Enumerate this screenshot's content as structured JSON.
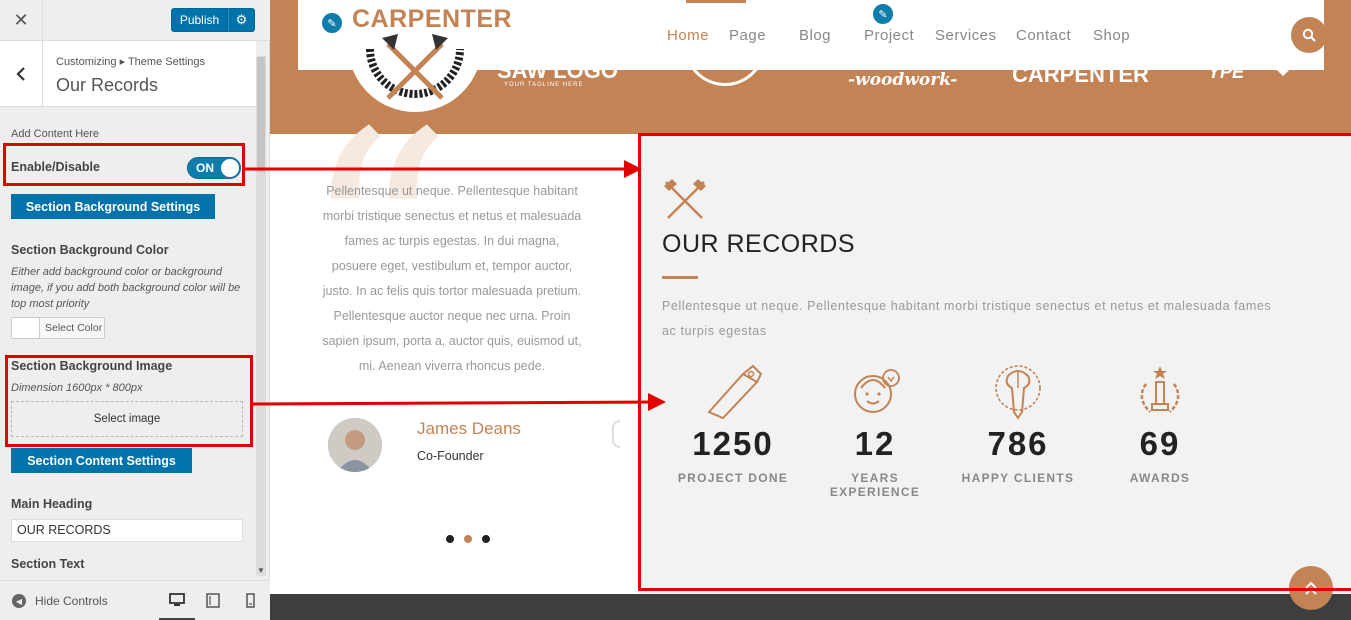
{
  "topbar": {
    "close_label": "✕",
    "publish_label": "Publish",
    "gear_label": "⚙"
  },
  "panel": {
    "breadcrumb": "Customizing ▸ Theme Settings",
    "title": "Our Records",
    "add_content_label": "Add Content Here",
    "enable_label": "Enable/Disable",
    "toggle_text": "ON",
    "toggle_on": true,
    "bg_settings_button": "Section Background Settings",
    "bg_color_label": "Section Background Color",
    "bg_color_help": "Either add background color or background image, if you add both background color will be top most priority",
    "select_color_label": "Select Color",
    "bg_image_label": "Section Background Image",
    "bg_image_dimension": "Dimension 1600px * 800px",
    "select_image_label": "Select image",
    "content_settings_button": "Section Content Settings",
    "main_heading_label": "Main Heading",
    "main_heading_value": "OUR RECORDS",
    "section_text_label": "Section Text"
  },
  "footer": {
    "hide_controls": "Hide Controls",
    "active_device": "desktop"
  },
  "site": {
    "logo_text": "CARPENTER",
    "nav": [
      "Home",
      "Page",
      "Blog",
      "Project",
      "Services",
      "Contact",
      "Shop"
    ],
    "active_nav": "Home",
    "brand_logos": [
      "SAW LOGO",
      "YOUR TAGLINE HERE",
      "-woodwork-",
      "CARPENTER",
      "YPE"
    ],
    "accent_color": "#c48354"
  },
  "testimonial": {
    "text": "Pellentesque ut neque. Pellentesque habitant morbi tristique senectus et netus et malesuada fames ac turpis egestas. In dui magna, posuere eget, vestibulum et, tempor auctor, justo. In ac felis quis tortor malesuada pretium. Pellentesque auctor neque nec urna. Proin sapien ipsum, porta a, auctor quis, euismod ut, mi. Aenean viverra rhoncus pede.",
    "author": "James Deans",
    "role": "Co-Founder",
    "active_dot": 2
  },
  "records": {
    "heading": "OUR RECORDS",
    "text": "Pellentesque ut neque. Pellentesque habitant morbi tristique senectus et netus et malesuada fames ac turpis egestas",
    "stats": [
      {
        "value": "1250",
        "label": "PROJECT DONE",
        "icon": "saw-icon"
      },
      {
        "value": "12",
        "label": "YEARS EXPERIENCE",
        "icon": "smiling-person-icon"
      },
      {
        "value": "786",
        "label": "HAPPY CLIENTS",
        "icon": "brain-pencil-icon"
      },
      {
        "value": "69",
        "label": "AWARDS",
        "icon": "trophy-laurel-icon"
      }
    ]
  }
}
